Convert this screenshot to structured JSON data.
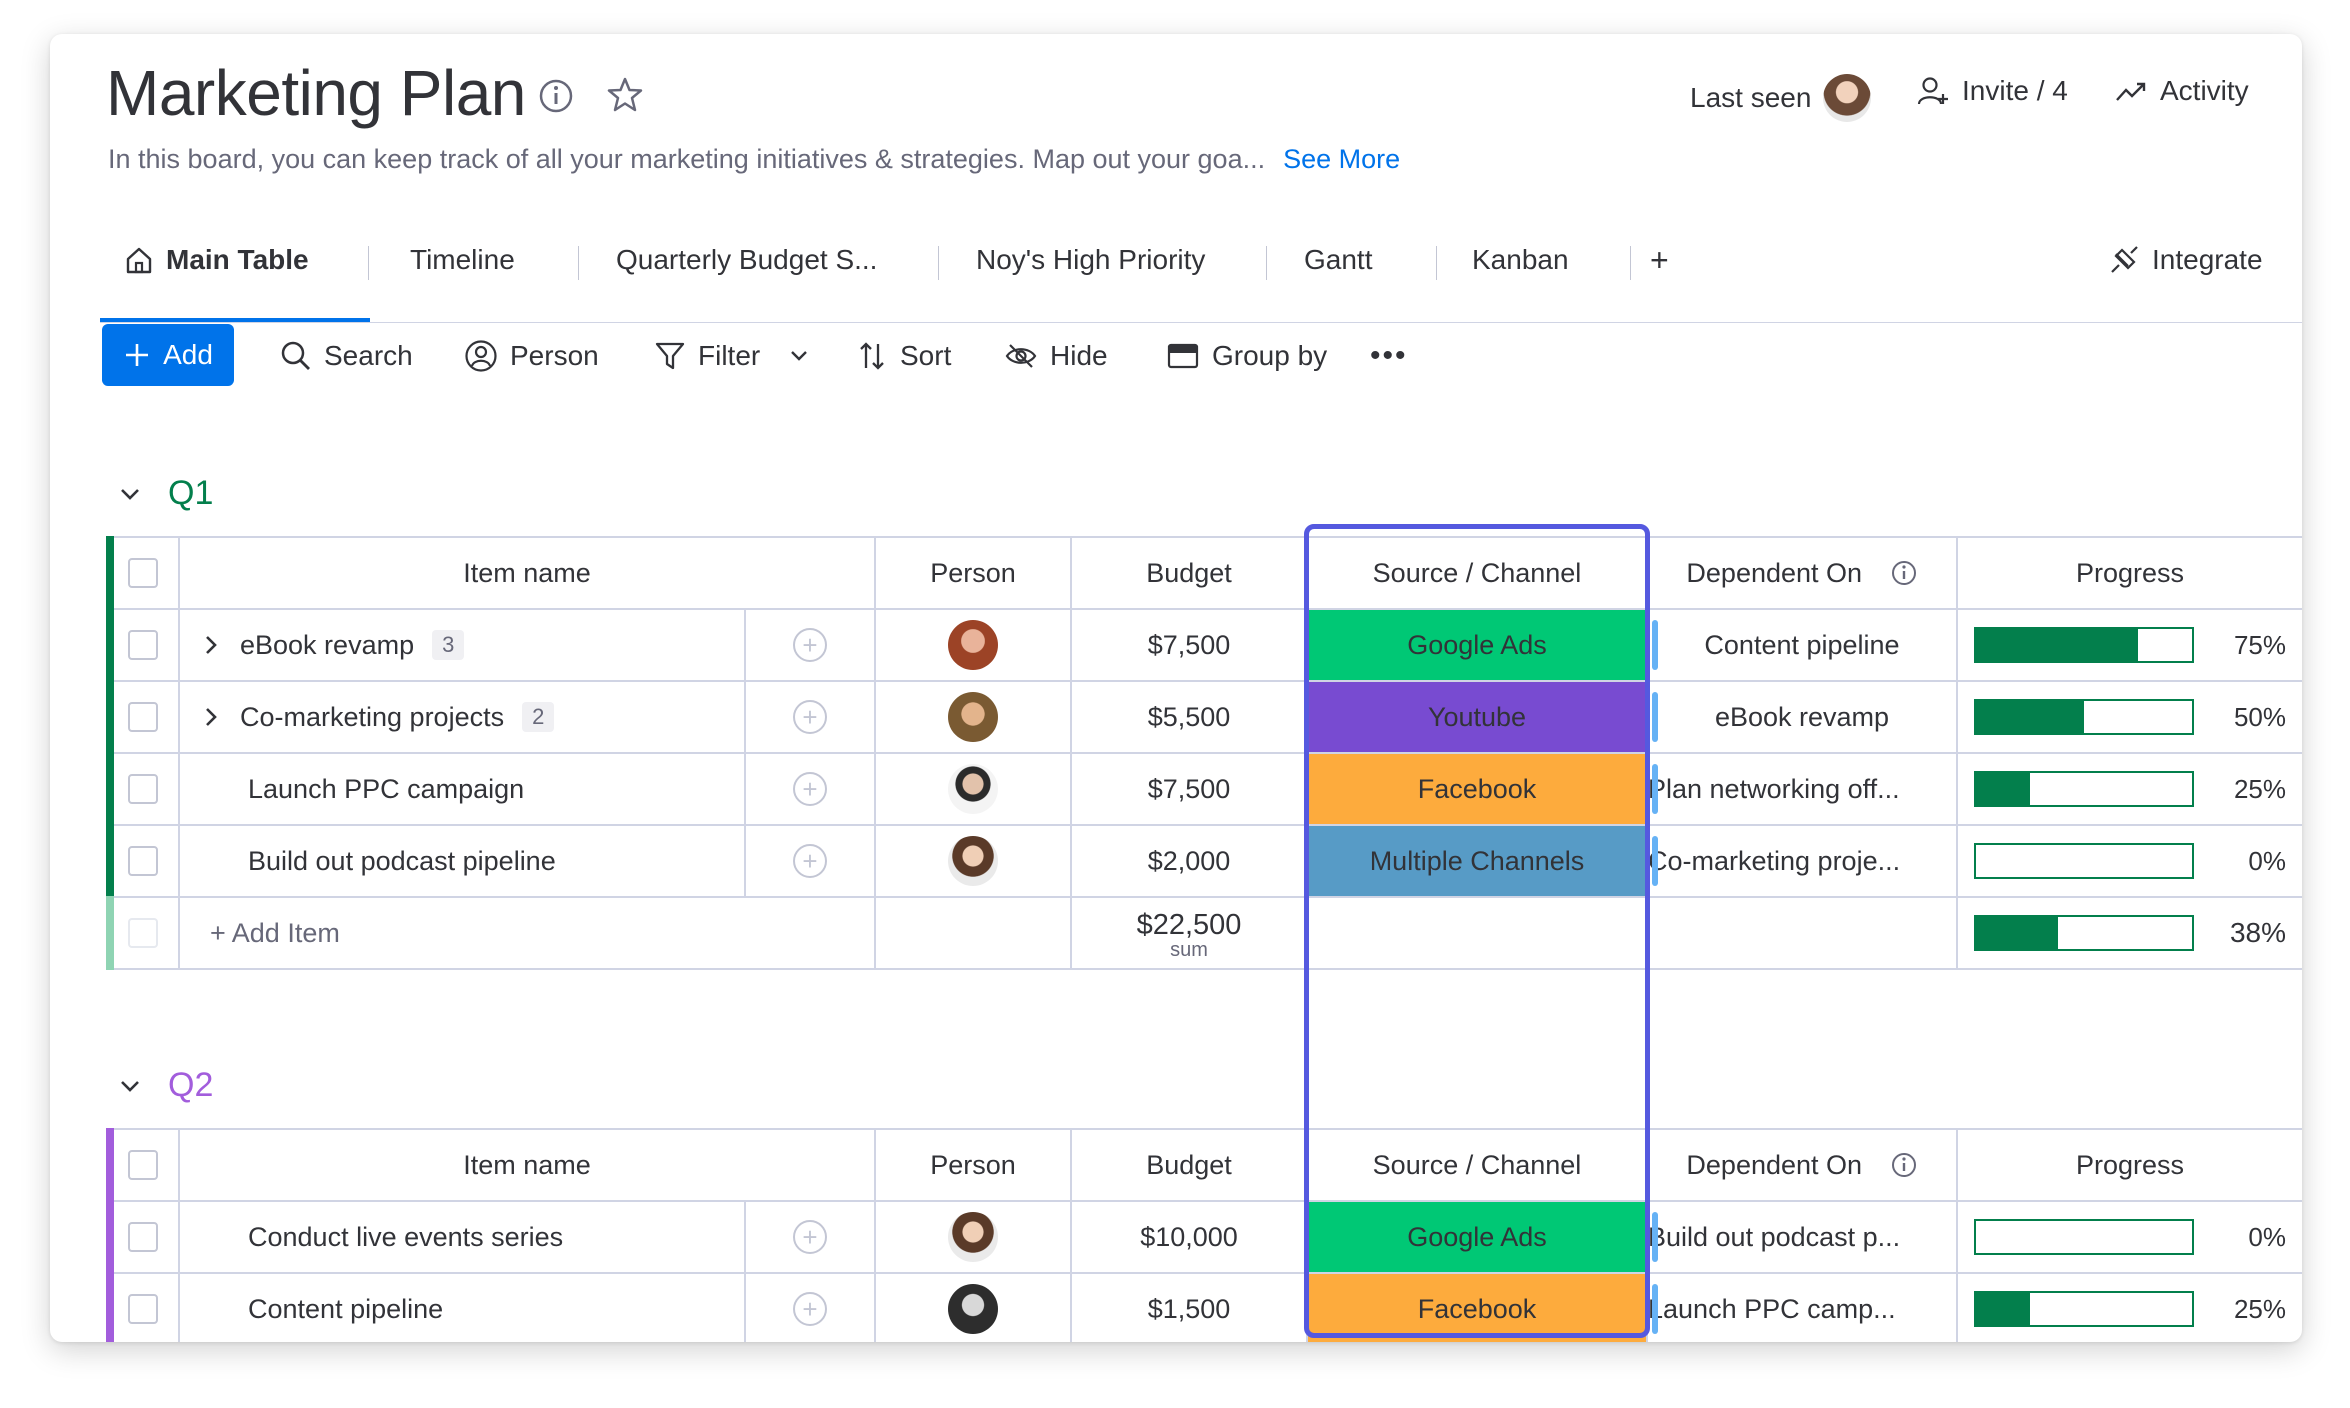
{
  "board": {
    "title": "Marketing Plan",
    "description": "In this board, you can keep track of all your marketing initiatives & strategies. Map out your goa...",
    "see_more": "See More"
  },
  "header_actions": {
    "last_seen": "Last seen",
    "invite": "Invite / 4",
    "activity": "Activity"
  },
  "tabs": [
    {
      "label": "Main Table",
      "active": true
    },
    {
      "label": "Timeline"
    },
    {
      "label": "Quarterly Budget S..."
    },
    {
      "label": "Noy's High Priority"
    },
    {
      "label": "Gantt"
    },
    {
      "label": "Kanban"
    },
    {
      "label": "+"
    }
  ],
  "integrate": "Integrate",
  "toolbar": {
    "add": "Add",
    "search": "Search",
    "person": "Person",
    "filter": "Filter",
    "sort": "Sort",
    "hide": "Hide",
    "group_by": "Group by",
    "more": "•••"
  },
  "columns": {
    "item_name": "Item name",
    "person": "Person",
    "budget": "Budget",
    "source": "Source / Channel",
    "dependent": "Dependent On",
    "progress": "Progress"
  },
  "colors": {
    "q1": "#037f4c",
    "q2": "#a25ddc",
    "google_ads": "#00c875",
    "youtube": "#784bd1",
    "facebook": "#fdab3d",
    "multiple": "#579bc6",
    "highlight": "#5559df"
  },
  "groups": [
    {
      "name": "Q1",
      "rows": [
        {
          "name": "eBook revamp",
          "subitems": "3",
          "budget": "$7,500",
          "channel": "Google Ads",
          "dependent": "Content pipeline",
          "progress": 75,
          "progress_label": "75%"
        },
        {
          "name": "Co-marketing projects",
          "subitems": "2",
          "budget": "$5,500",
          "channel": "Youtube",
          "dependent": "eBook revamp",
          "progress": 50,
          "progress_label": "50%"
        },
        {
          "name": "Launch PPC campaign",
          "budget": "$7,500",
          "channel": "Facebook",
          "dependent": "Plan networking off...",
          "progress": 25,
          "progress_label": "25%"
        },
        {
          "name": "Build out podcast pipeline",
          "budget": "$2,000",
          "channel": "Multiple Channels",
          "dependent": "Co-marketing proje...",
          "progress": 0,
          "progress_label": "0%"
        }
      ],
      "add_item": "+ Add Item",
      "sum_value": "$22,500",
      "sum_label": "sum",
      "total_progress": 38,
      "total_progress_label": "38%"
    },
    {
      "name": "Q2",
      "rows": [
        {
          "name": "Conduct live events series",
          "budget": "$10,000",
          "channel": "Google Ads",
          "dependent": "Build out podcast p...",
          "progress": 0,
          "progress_label": "0%"
        },
        {
          "name": "Content pipeline",
          "budget": "$1,500",
          "channel": "Facebook",
          "dependent": "Launch PPC camp...",
          "progress": 25,
          "progress_label": "25%"
        }
      ]
    }
  ]
}
